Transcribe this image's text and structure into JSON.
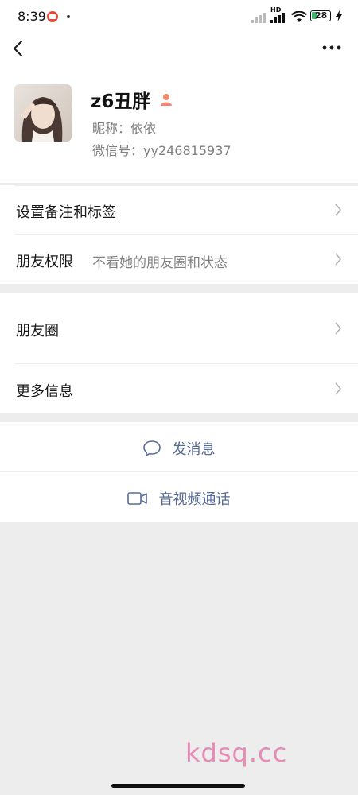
{
  "status_bar": {
    "time": "8:39",
    "battery": "28",
    "network_label": "HD",
    "icons": [
      "notification-icon",
      "signal-icon",
      "wifi-icon",
      "battery-icon",
      "charging-icon"
    ]
  },
  "header": {
    "back_icon": "back-icon",
    "more_icon": "more-icon"
  },
  "profile": {
    "name": "z6丑胖",
    "nickname": "昵称：依依",
    "wechat_id": "微信号：yy246815937",
    "badge_color": "#f08a6e"
  },
  "rows": {
    "remark": {
      "label": "设置备注和标签"
    },
    "permission": {
      "label": "朋友权限",
      "value": "不看她的朋友圈和状态"
    },
    "moments": {
      "label": "朋友圈"
    },
    "more_info": {
      "label": "更多信息"
    }
  },
  "actions": {
    "message": {
      "label": "发消息",
      "icon": "chat-bubble-icon"
    },
    "video_call": {
      "label": "音视频通话",
      "icon": "video-camera-icon"
    }
  },
  "colors": {
    "accent_link": "#576b95",
    "background": "#ededed"
  },
  "watermark": "kdsq.cc"
}
